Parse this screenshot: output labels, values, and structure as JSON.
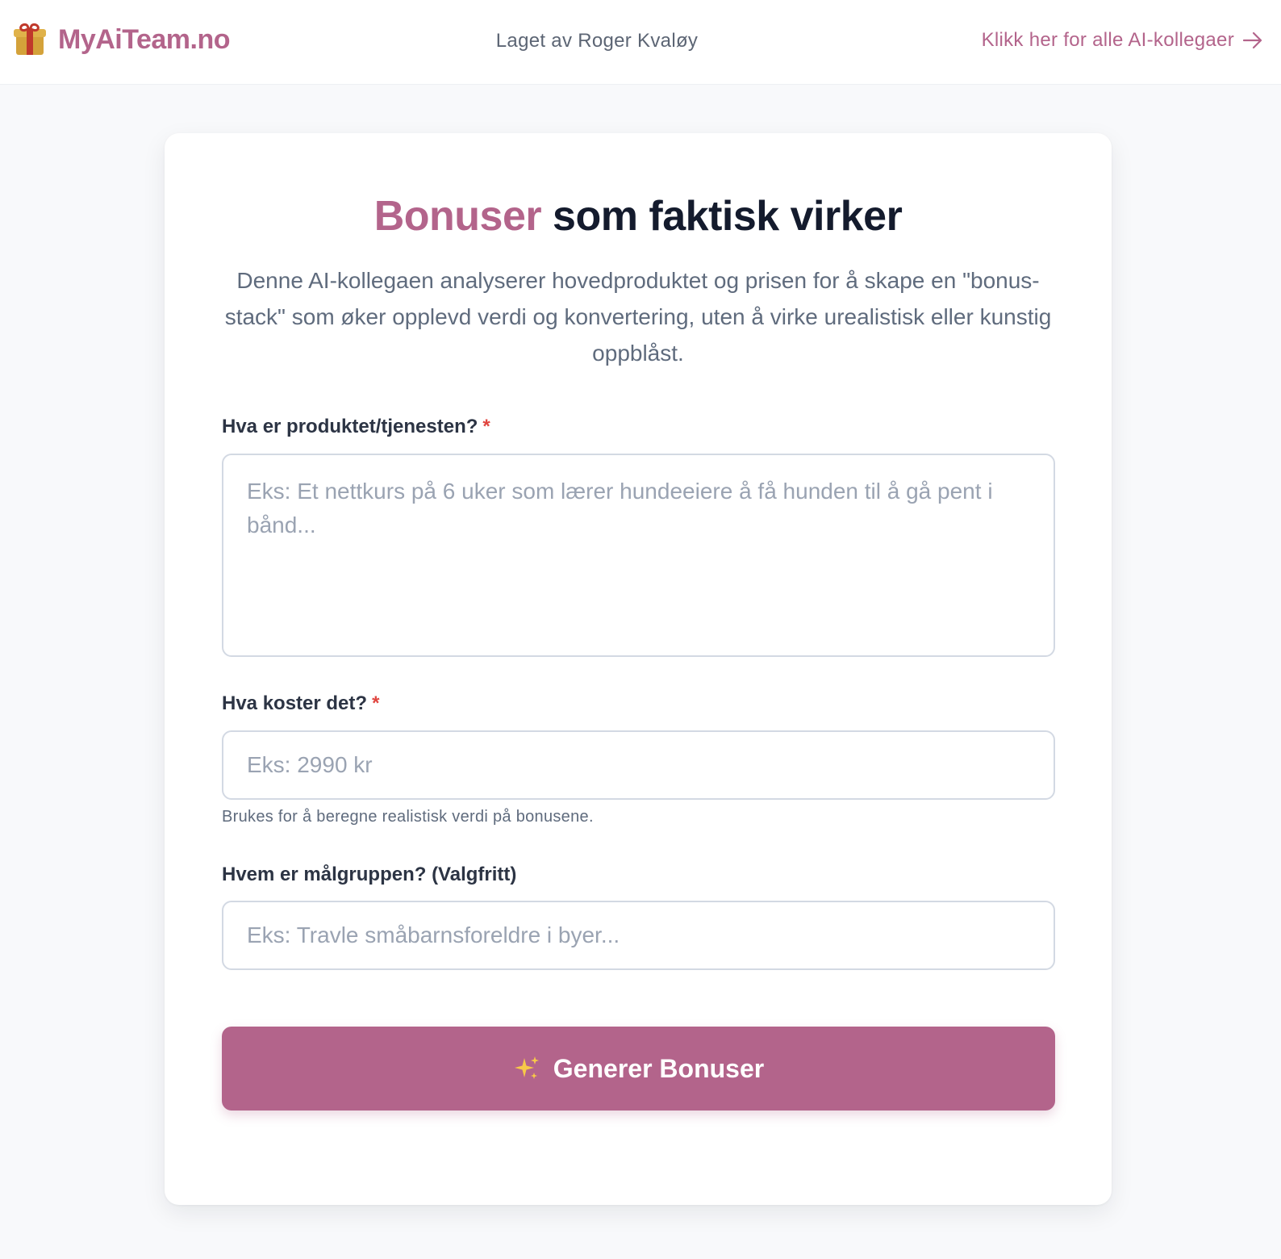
{
  "header": {
    "brand_name": "MyAiTeam.no",
    "brand_icon": "gift-icon",
    "made_by": "Laget av Roger Kvaløy",
    "all_colleagues_link": "Klikk her for alle AI-kollegaer",
    "link_icon": "arrow-right-icon"
  },
  "hero": {
    "title_accent": "Bonuser",
    "title_rest": " som faktisk virker",
    "description": "Denne AI-kollegaen analyserer hovedproduktet og prisen for å skape en \"bonus-stack\" som øker opplevd verdi og konvertering, uten å virke urealistisk eller kunstig oppblåst."
  },
  "form": {
    "product": {
      "label": "Hva er produktet/tjenesten?",
      "required_marker": "*",
      "placeholder": "Eks: Et nettkurs på 6 uker som lærer hundeeiere å få hunden til å gå pent i bånd...",
      "value": ""
    },
    "price": {
      "label": "Hva koster det?",
      "required_marker": "*",
      "placeholder": "Eks: 2990 kr",
      "value": "",
      "hint": "Brukes for å beregne realistisk verdi på bonusene."
    },
    "audience": {
      "label": "Hvem er målgruppen? (Valgfritt)",
      "placeholder": "Eks: Travle småbarnsforeldre i byer...",
      "value": ""
    },
    "submit_label": "Generer Bonuser",
    "submit_icon": "sparkles-icon"
  },
  "colors": {
    "brand": "#b3648b",
    "heading": "#141b2d",
    "muted_text": "#5f6b7d",
    "required": "#e0453f",
    "page_bg": "#f8f9fb"
  }
}
